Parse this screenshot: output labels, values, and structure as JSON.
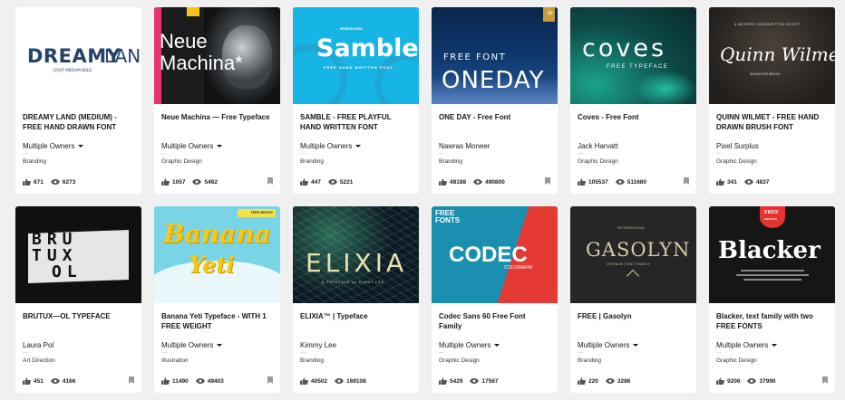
{
  "projects": [
    {
      "title": "DREAMY LAND (MEDIUM) - FREE HAND DRAWN FONT",
      "owner": "Multiple Owners",
      "owner_dropdown": true,
      "field": "Branding",
      "likes": "671",
      "views": "6273",
      "bookmark": false,
      "thumb": {
        "bg": "#ffffff",
        "texts": [
          "DREAMY",
          "LAND",
          "LIGHT   MEDIUM   BOLD"
        ]
      }
    },
    {
      "title": "Neue Machina — Free Typeface",
      "owner": "Multiple Owners",
      "owner_dropdown": true,
      "field": "Graphic Design",
      "likes": "1057",
      "views": "5462",
      "bookmark": true,
      "thumb": {
        "bg": "#1c1c1e",
        "texts": [
          "Neue",
          "Machina*"
        ]
      }
    },
    {
      "title": "SAMBLE - FREE PLAYFUL HAND WRITTEN FONT",
      "owner": "Multiple Owners",
      "owner_dropdown": true,
      "field": "Branding",
      "likes": "447",
      "views": "5221",
      "bookmark": false,
      "thumb": {
        "bg": "#16b5e6",
        "texts": [
          "INTRODUCING",
          "Samble",
          "FREE HAND WRITTEN FONT"
        ]
      }
    },
    {
      "title": "ONE DAY - Free Font",
      "owner": "Nawras Moneer",
      "owner_dropdown": false,
      "field": "Branding",
      "likes": "48188",
      "views": "490800",
      "bookmark": true,
      "thumb": {
        "bg": "#0d2a55",
        "texts": [
          "FREE FONT",
          "ONEDAY",
          "Gr"
        ]
      }
    },
    {
      "title": "Coves - Free Font",
      "owner": "Jack Harvatt",
      "owner_dropdown": false,
      "field": "Graphic Design",
      "likes": "105537",
      "views": "511680",
      "bookmark": true,
      "thumb": {
        "bg": "#0f4f4c",
        "texts": [
          "coves",
          "FREE TYPEFACE"
        ]
      }
    },
    {
      "title": "QUINN WILMET - FREE HAND DRAWN BRUSH FONT",
      "owner": "Pixel Surplus",
      "owner_dropdown": false,
      "field": "Graphic Design",
      "likes": "341",
      "views": "4837",
      "bookmark": false,
      "thumb": {
        "bg": "#2a2622",
        "texts": [
          "A MODERN HANDWRITTEN SCRIPT",
          "Quinn Wilmet",
          "SIGNATURE BRUSH"
        ]
      }
    },
    {
      "title": "BRUTUX—OL TYPEFACE",
      "owner": "Laura Pol",
      "owner_dropdown": false,
      "field": "Art Direction",
      "likes": "451",
      "views": "4166",
      "bookmark": true,
      "thumb": {
        "bg": "#101010",
        "texts": [
          "BRU",
          "TUX",
          "OL"
        ]
      }
    },
    {
      "title": "Banana Yeti Typeface - WITH 1 FREE WEIGHT",
      "owner": "Multiple Owners",
      "owner_dropdown": true,
      "field": "Illustration",
      "likes": "11490",
      "views": "49403",
      "bookmark": true,
      "thumb": {
        "bg": "#79d4e6",
        "texts": [
          "Banana",
          "Yeti",
          "FREE WEIGHT"
        ]
      }
    },
    {
      "title": "ELIXIA™ | Typeface",
      "owner": "Kimmy Lee",
      "owner_dropdown": false,
      "field": "Branding",
      "likes": "40502",
      "views": "169108",
      "bookmark": false,
      "thumb": {
        "bg": "#0b1a24",
        "texts": [
          "ELIXIA",
          "A TYPEFACE by KIMMY LEE"
        ]
      }
    },
    {
      "title": "Codec Sans 60 Free Font Family",
      "owner": "Multiple Owners",
      "owner_dropdown": true,
      "field": "Graphic Design",
      "likes": "5429",
      "views": "17567",
      "bookmark": false,
      "thumb": {
        "bg": "#1b8fb0",
        "texts": [
          "FREE",
          "FONTS",
          "CODEC",
          "COLD/WARM"
        ]
      }
    },
    {
      "title": "FREE | Gasolyn",
      "owner": "Multiple Owners",
      "owner_dropdown": true,
      "field": "Branding",
      "likes": "220",
      "views": "3286",
      "bookmark": false,
      "thumb": {
        "bg": "#262626",
        "texts": [
          "INTRODUCING",
          "GASOLYN",
          "VINTAGE FONT FAMILY"
        ]
      }
    },
    {
      "title": "Blacker, text family with two FREE FONTS",
      "owner": "Multiple Owners",
      "owner_dropdown": true,
      "field": "Graphic Design",
      "likes": "9206",
      "views": "37990",
      "bookmark": true,
      "thumb": {
        "bg": "#161616",
        "texts": [
          "FREE",
          "WEIGHTS",
          "Blacker"
        ]
      }
    }
  ]
}
